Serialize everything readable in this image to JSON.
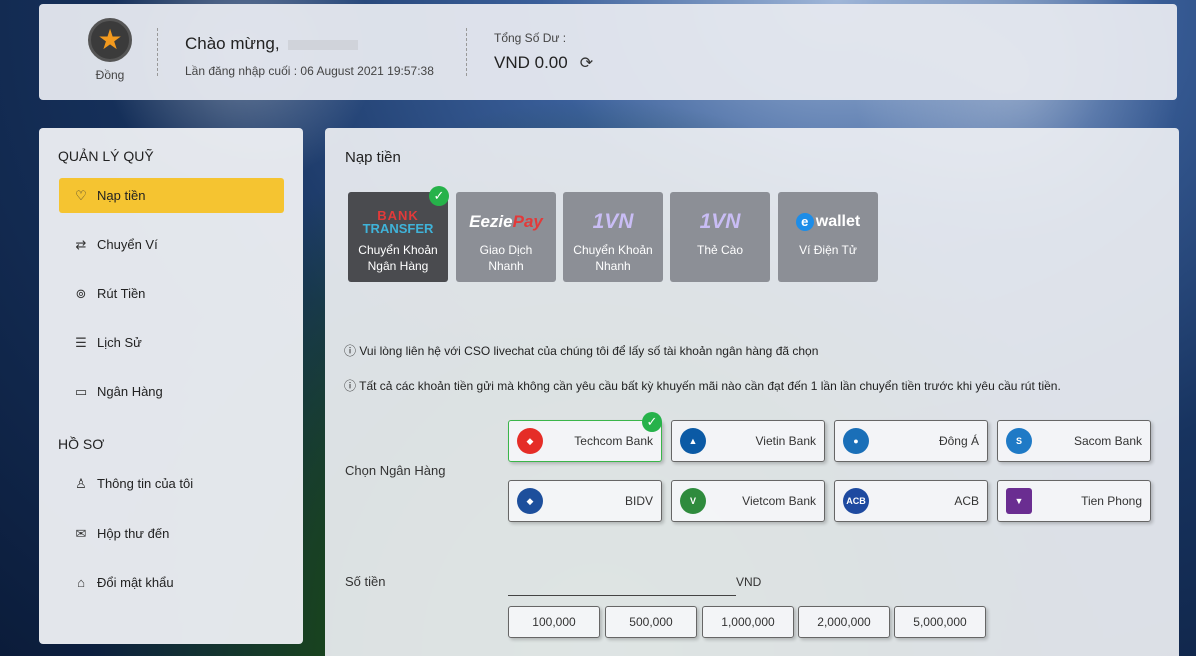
{
  "header": {
    "rank_label": "Đồng",
    "welcome": "Chào mừng,",
    "last_login": "Lần đăng nhập cuối : 06 August 2021 19:57:38",
    "balance_label": "Tổng Số Dư :",
    "balance_value": "VND  0.00"
  },
  "sidebar": {
    "fund_title": "QUẢN LÝ QUỸ",
    "fund_items": [
      {
        "label": "Nạp tiền",
        "icon": "piggy-bank-icon"
      },
      {
        "label": "Chuyển Ví",
        "icon": "transfer-arrows-icon"
      },
      {
        "label": "Rút Tiền",
        "icon": "coin-icon"
      },
      {
        "label": "Lịch Sử",
        "icon": "list-icon"
      },
      {
        "label": "Ngân Hàng",
        "icon": "card-icon"
      }
    ],
    "profile_title": "HỒ SƠ",
    "profile_items": [
      {
        "label": "Thông tin của tôi",
        "icon": "user-icon"
      },
      {
        "label": "Hộp thư đến",
        "icon": "mail-icon"
      },
      {
        "label": "Đổi mật khẩu",
        "icon": "lock-icon"
      }
    ]
  },
  "main": {
    "title": "Nạp tiền",
    "methods": [
      {
        "label1": "Chuyển Khoản",
        "label2": "Ngân Hàng",
        "logo": "bank-transfer-logo",
        "logo_text1": "BANK",
        "logo_text2": "TRANSFER"
      },
      {
        "label1": "Giao Dịch",
        "label2": "Nhanh",
        "logo": "eeziepay-logo",
        "logo_text1": "Eezie",
        "logo_text2": "Pay"
      },
      {
        "label1": "Chuyển Khoản",
        "label2": "Nhanh",
        "logo": "1vn-pay-logo",
        "logo_text1": "1VN"
      },
      {
        "label1": "Thẻ Cào",
        "label2": "",
        "logo": "1vn-card-logo",
        "logo_text1": "1VN"
      },
      {
        "label1": "Ví Điện Tử",
        "label2": "",
        "logo": "ewallet-logo",
        "logo_text1": "e",
        "logo_text2": "wallet"
      }
    ],
    "note1": "ⓘ Vui lòng liên hệ với CSO livechat của chúng tôi để lấy số tài khoản ngân hàng đã chọn",
    "note2": "ⓘ Tất cả các khoản tiền gửi mà không cần yêu cầu bất kỳ khuyến mãi nào cần đạt đến 1 lần lần chuyển tiền trước khi yêu cầu rút tiền.",
    "bank_label": "Chọn Ngân Hàng",
    "banks": [
      {
        "name": "Techcom Bank",
        "color": "#e52d27",
        "abbr": ""
      },
      {
        "name": "Vietin Bank",
        "color": "#0b5aa5",
        "abbr": ""
      },
      {
        "name": "Đông Á",
        "color": "#1a6fb8",
        "abbr": ""
      },
      {
        "name": "Sacom Bank",
        "color": "#1f7ac6",
        "abbr": ""
      },
      {
        "name": "BIDV",
        "color": "#1d4f9c",
        "abbr": ""
      },
      {
        "name": "Vietcom Bank",
        "color": "#2e8b3d",
        "abbr": ""
      },
      {
        "name": "ACB",
        "color": "#1e4aa0",
        "abbr": "ACB"
      },
      {
        "name": "Tien Phong",
        "color": "#6a2d91",
        "abbr": ""
      }
    ],
    "amount_label": "Số tiền",
    "currency": "VND",
    "amount_chips": [
      "100,000",
      "500,000",
      "1,000,000",
      "2,000,000",
      "5,000,000"
    ]
  }
}
